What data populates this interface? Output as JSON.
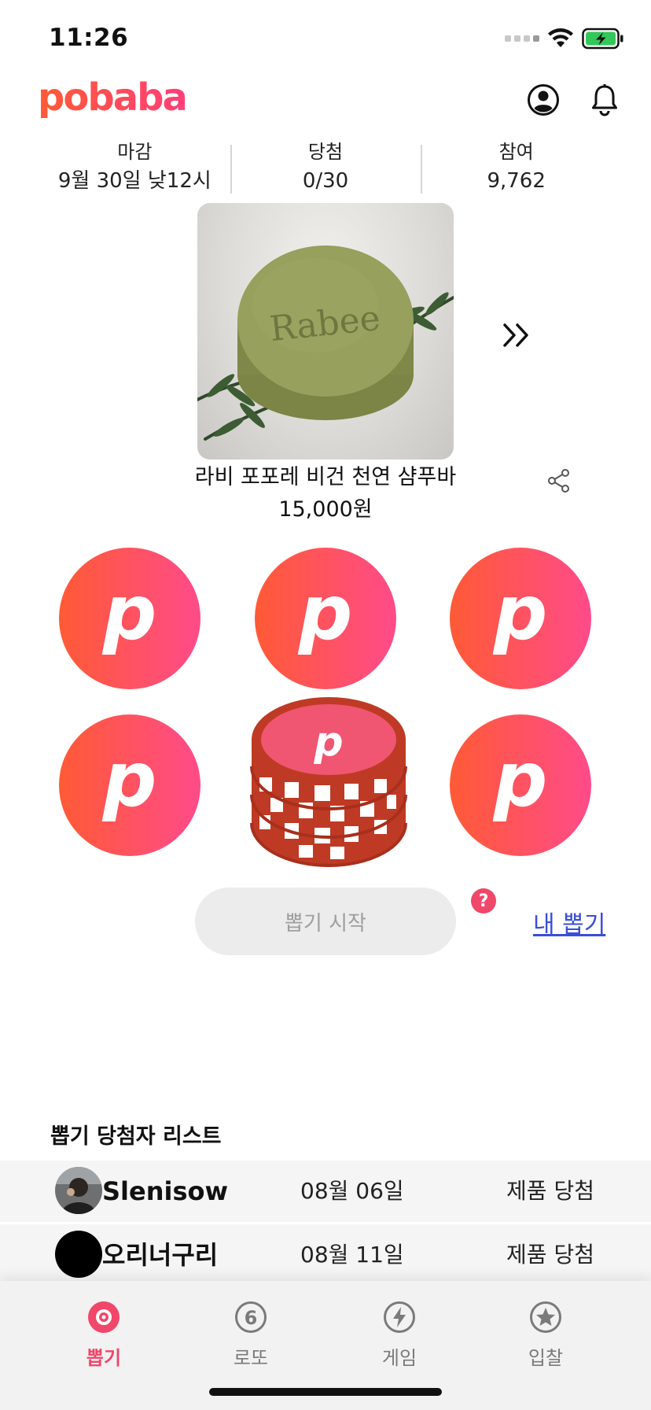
{
  "status_bar": {
    "time": "11:26"
  },
  "brand": {
    "logo": "pobaba",
    "accent": "#f0476a",
    "gradient_start": "#ff5a36",
    "gradient_end": "#ff4b8a"
  },
  "header": {
    "icons": [
      "profile-icon",
      "bell-icon"
    ]
  },
  "stats": [
    {
      "label": "마감",
      "value": "9월 30일 낮12시"
    },
    {
      "label": "당첨",
      "value": "0/30"
    },
    {
      "label": "참여",
      "value": "9,762"
    }
  ],
  "product": {
    "image_text": "Rabee",
    "name": "라비 포포레 비건 천연 샴푸바",
    "price": "15,000원"
  },
  "coins": {
    "letter": "p",
    "count": 6
  },
  "draw": {
    "start_label": "뽑기 시작",
    "help_label": "?",
    "my_draw_label": "내 뽑기"
  },
  "winners": {
    "title": "뽑기 당첨자 리스트",
    "rows": [
      {
        "name": "Slenisow",
        "date": "08월 06일",
        "result": "제품 당첨"
      },
      {
        "name": "오리너구리",
        "date": "08월 11일",
        "result": "제품 당첨"
      }
    ]
  },
  "tabs": [
    {
      "label": "뽑기",
      "icon": "draw-icon",
      "active": true
    },
    {
      "label": "로또",
      "icon": "lotto-icon",
      "active": false
    },
    {
      "label": "게임",
      "icon": "game-icon",
      "active": false
    },
    {
      "label": "입찰",
      "icon": "bid-icon",
      "active": false
    }
  ]
}
